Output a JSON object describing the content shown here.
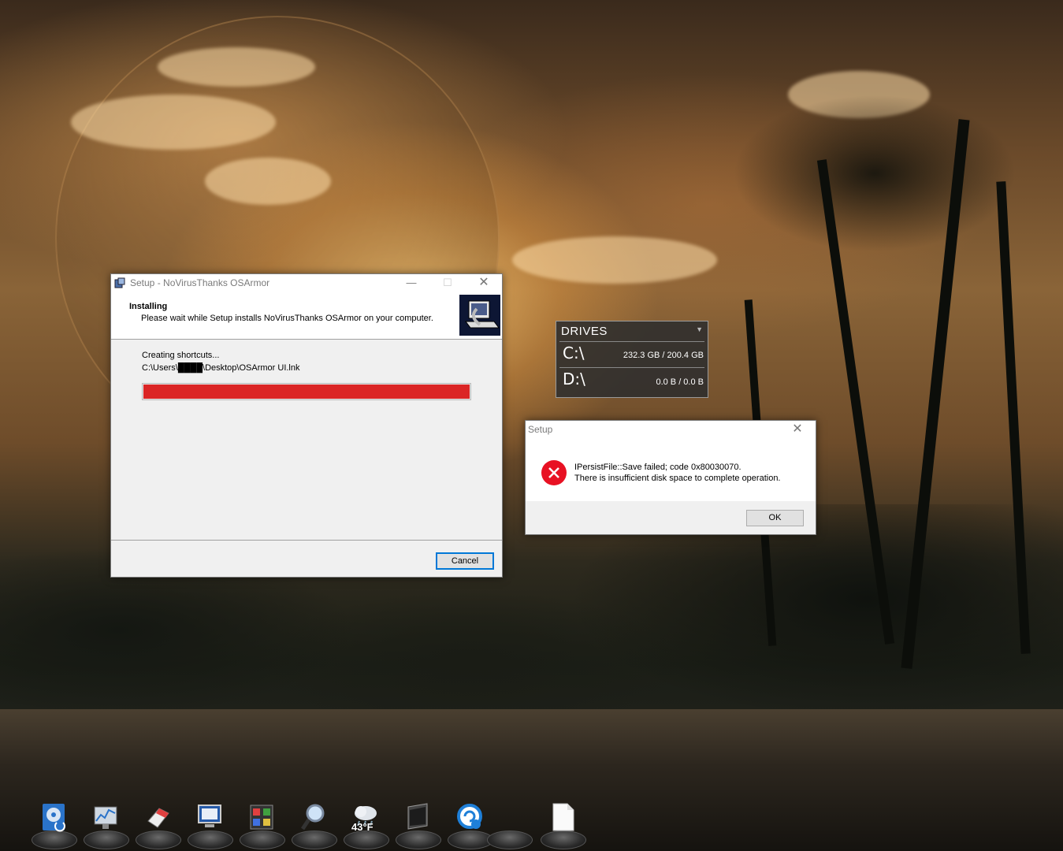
{
  "setup_window": {
    "title": "Setup - NoVirusThanks OSArmor",
    "header_title": "Installing",
    "header_subtitle": "Please wait while Setup installs NoVirusThanks OSArmor on your computer.",
    "status_line": "Creating shortcuts...",
    "path_line": "C:\\Users\\████\\Desktop\\OSArmor UI.lnk",
    "progress": 1.0,
    "progress_color": "#db2525",
    "cancel_label": "Cancel"
  },
  "drives_gadget": {
    "title": "DRIVES",
    "drives": [
      {
        "letter": "C:\\",
        "usage": "232.3 GB / 200.4 GB"
      },
      {
        "letter": "D:\\",
        "usage": "0.0 B / 0.0 B"
      }
    ]
  },
  "error_dialog": {
    "title": "Setup",
    "line1": "IPersistFile::Save failed; code 0x80030070.",
    "line2": "There is insufficient disk space to complete operation.",
    "ok_label": "OK",
    "icon": "error-icon"
  },
  "dock": {
    "items": [
      {
        "name": "disk-tool",
        "icon": "hard-drive-icon"
      },
      {
        "name": "system-monitor",
        "icon": "monitor-graph-icon"
      },
      {
        "name": "cleaner",
        "icon": "eraser-icon"
      },
      {
        "name": "computer",
        "icon": "computer-icon"
      },
      {
        "name": "control-panel",
        "icon": "tools-icon"
      },
      {
        "name": "search",
        "icon": "magnifier-icon"
      },
      {
        "name": "weather",
        "icon": "weather-cloud-icon",
        "temp": "43°F"
      },
      {
        "name": "launcher",
        "icon": "window-3d-icon"
      },
      {
        "name": "sync-app",
        "icon": "sync-s-icon"
      },
      {
        "name": "empty-slot",
        "icon": "blank-icon"
      },
      {
        "name": "document",
        "icon": "document-icon"
      }
    ]
  }
}
